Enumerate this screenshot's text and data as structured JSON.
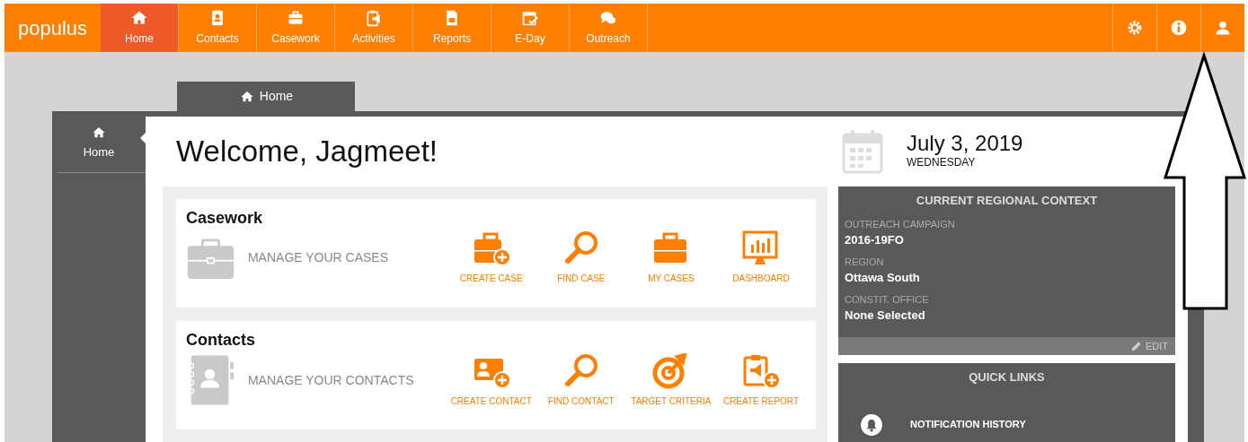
{
  "brand": "populus",
  "nav": [
    {
      "label": "Home",
      "selected": true
    },
    {
      "label": "Contacts",
      "selected": false
    },
    {
      "label": "Casework",
      "selected": false
    },
    {
      "label": "Activities",
      "selected": false
    },
    {
      "label": "Reports",
      "selected": false
    },
    {
      "label": "E-Day",
      "selected": false
    },
    {
      "label": "Outreach",
      "selected": false
    }
  ],
  "page_tab": {
    "label": "Home"
  },
  "sidebar": {
    "items": [
      {
        "label": "Home",
        "selected": true
      }
    ]
  },
  "welcome": "Welcome, Jagmeet!",
  "date": {
    "date": "July 3, 2019",
    "weekday": "WEDNESDAY"
  },
  "sections": [
    {
      "title": "Casework",
      "subtitle": "MANAGE YOUR CASES",
      "actions": [
        "CREATE CASE",
        "FIND CASE",
        "MY CASES",
        "DASHBOARD"
      ]
    },
    {
      "title": "Contacts",
      "subtitle": "MANAGE YOUR CONTACTS",
      "actions": [
        "CREATE CONTACT",
        "FIND CONTACT",
        "TARGET CRITERIA",
        "CREATE REPORT"
      ]
    }
  ],
  "regional_context": {
    "title": "CURRENT REGIONAL CONTEXT",
    "fields": [
      {
        "label": "OUTREACH CAMPAIGN",
        "value": "2016-19FO"
      },
      {
        "label": "REGION",
        "value": "Ottawa South"
      },
      {
        "label": "CONSTIT. OFFICE",
        "value": "None Selected"
      }
    ],
    "edit": "EDIT"
  },
  "quick_links": {
    "title": "QUICK LINKS",
    "items": [
      {
        "label": "NOTIFICATION HISTORY"
      }
    ]
  }
}
